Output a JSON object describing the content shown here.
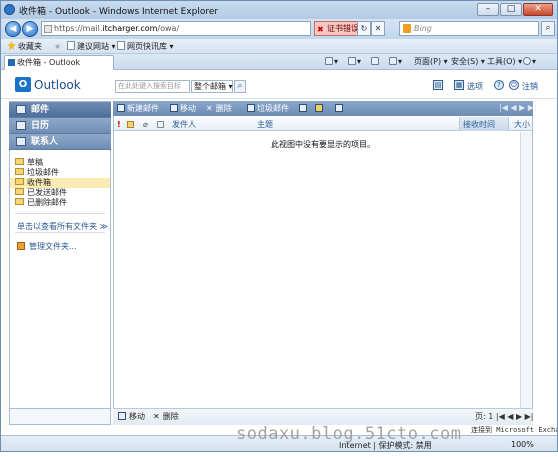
{
  "window": {
    "title": "收件箱 - Outlook - Windows Internet Explorer",
    "minimize": "–",
    "maximize": "□",
    "close": "✕"
  },
  "browser": {
    "url_prefix": "https://mail.",
    "url_domain": "itcharger.com",
    "url_suffix": "/owa/",
    "cert_error": "证书错误",
    "search_placeholder": "Bing",
    "favorites_label": "收藏夹",
    "fav_items": [
      "建议网站 ▾",
      "网页快讯库 ▾"
    ],
    "tab_title": "收件箱 - Outlook",
    "command_items": [
      "页面(P) ▾",
      "安全(S) ▾",
      "工具(O) ▾"
    ],
    "help_icon": "?"
  },
  "owa": {
    "product": "Outlook",
    "find_placeholder": "在此处键入搜索目标",
    "scope": "整个邮箱",
    "options": "选项",
    "signout": "注销",
    "help": "?",
    "nav": {
      "sections": [
        {
          "label": "邮件",
          "icon": "mail-icon"
        },
        {
          "label": "日历",
          "icon": "calendar-icon"
        },
        {
          "label": "联系人",
          "icon": "contacts-icon"
        }
      ],
      "folders": [
        "草稿",
        "垃圾邮件",
        "收件箱",
        "已发送邮件",
        "已删除邮件"
      ],
      "all_folders": "单击以查看所有文件夹 ≫",
      "manage_folders": "管理文件夹..."
    },
    "toolbar": {
      "new": "新建邮件",
      "move": "移动",
      "delete": "删除",
      "junk": "垃圾邮件",
      "pager": "|◀ ◀ ▶ ▶|"
    },
    "columns": {
      "from": "发件人",
      "subject": "主题",
      "received": "接收时间",
      "size": "大小"
    },
    "empty_message": "此视图中没有要显示的项目。",
    "bottom": {
      "move": "移动",
      "delete": "删除",
      "page": "页: 1  |◀ ◀ ▶ ▶|"
    },
    "ms_logo": "连接到 Microsoft Exchange"
  },
  "status": {
    "zone": "Internet | 保护模式: 禁用",
    "zoom": "100%"
  },
  "watermark": "sodaxu.blog.51cto.com"
}
